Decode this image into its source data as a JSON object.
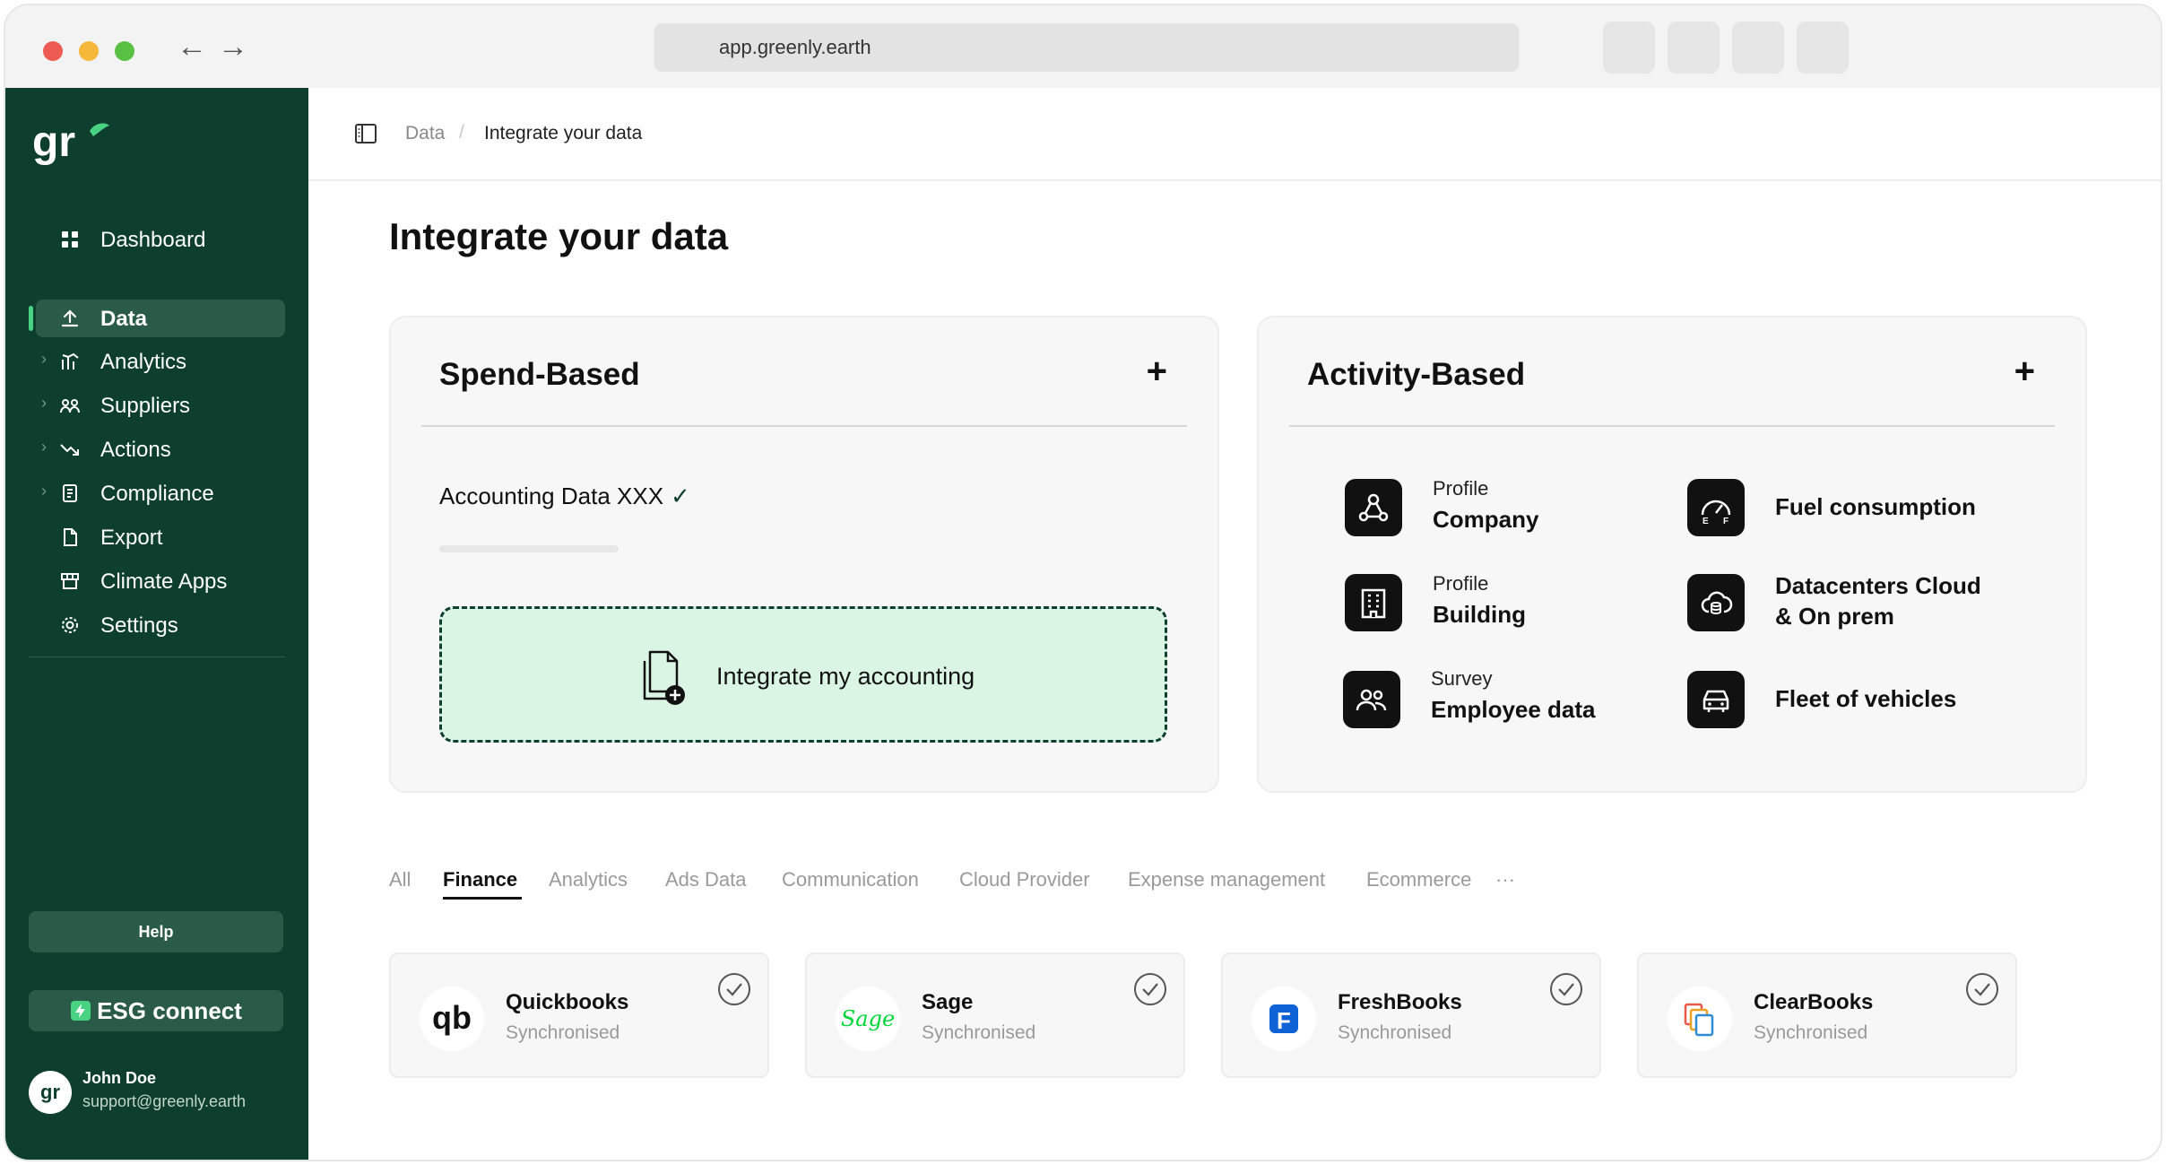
{
  "browser": {
    "url": "app.greenly.earth"
  },
  "sidebar": {
    "logo_text": "gr",
    "items": [
      {
        "label": "Dashboard",
        "icon": "grid-icon"
      },
      {
        "label": "Data",
        "icon": "upload-icon",
        "active": true
      },
      {
        "label": "Analytics",
        "icon": "analytics-icon"
      },
      {
        "label": "Suppliers",
        "icon": "suppliers-icon"
      },
      {
        "label": "Actions",
        "icon": "trend-down-icon"
      },
      {
        "label": "Compliance",
        "icon": "document-icon"
      },
      {
        "label": "Export",
        "icon": "file-icon"
      },
      {
        "label": "Climate Apps",
        "icon": "store-icon"
      },
      {
        "label": "Settings",
        "icon": "gear-icon"
      }
    ],
    "help_label": "Help",
    "esg_label": "ESG connect",
    "user": {
      "avatar_text": "gr",
      "name": "John Doe",
      "email": "support@greenly.earth"
    }
  },
  "breadcrumb": {
    "parent": "Data",
    "separator": "/",
    "current": "Integrate your data"
  },
  "page_title": "Integrate your data",
  "spend": {
    "title": "Spend-Based",
    "plus": "+",
    "accounting_item": "Accounting Data XXX",
    "check": "✓",
    "dropzone_label": "Integrate my accounting"
  },
  "activity": {
    "title": "Activity-Based",
    "plus": "+",
    "items": [
      {
        "sub": "Profile",
        "main": "Company",
        "icon": "network-icon"
      },
      {
        "sub": "",
        "main": "Fuel consumption",
        "icon": "fuel-gauge-icon"
      },
      {
        "sub": "Profile",
        "main": "Building",
        "icon": "building-icon"
      },
      {
        "sub": "",
        "main": "Datacenters Cloud",
        "main2": "& On prem",
        "icon": "cloud-database-icon"
      },
      {
        "sub": "Survey",
        "main": "Employee data",
        "icon": "users-icon"
      },
      {
        "sub": "",
        "main": "Fleet of vehicles",
        "icon": "car-icon"
      }
    ]
  },
  "tabs": [
    "All",
    "Finance",
    "Analytics",
    "Ads Data",
    "Communication",
    "Cloud Provider",
    "Expense management",
    "Ecommerce",
    "···"
  ],
  "active_tab": "Finance",
  "integrations": [
    {
      "name": "Quickbooks",
      "status": "Synchronised",
      "logo": "qb",
      "color": "#111111"
    },
    {
      "name": "Sage",
      "status": "Synchronised",
      "logo": "Sage",
      "color": "#00d639"
    },
    {
      "name": "FreshBooks",
      "status": "Synchronised",
      "logo": "F",
      "color": "#0f62d6"
    },
    {
      "name": "ClearBooks",
      "status": "Synchronised",
      "logo": "cb",
      "color": "#2e8bd6"
    }
  ],
  "colors": {
    "sidebar_bg": "#0e3f2e",
    "accent_green": "#49d282",
    "dropzone_bg": "#daf5e4"
  }
}
